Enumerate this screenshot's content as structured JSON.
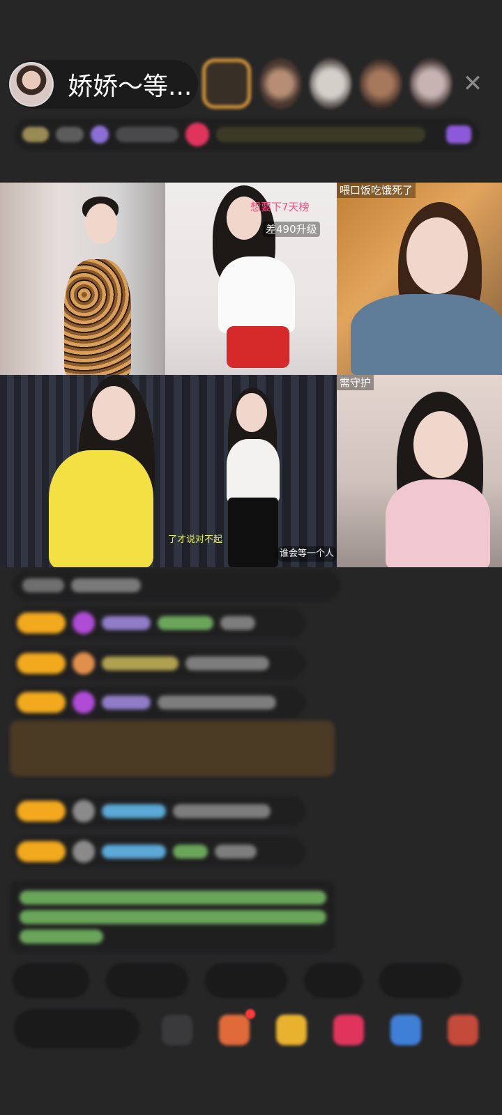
{
  "header": {
    "host_name": "娇娇～等..."
  },
  "streams": {
    "tile2_top": "想要下7天榜",
    "tile2_level": "差490升级",
    "tile3_top": "喂口饭吃饿死了",
    "tile4_bottom": "了才说对不起",
    "tile5_bottom": "谁会等一个人",
    "tile6_top": "需守护"
  },
  "icons": {
    "close": "close-icon",
    "gift": "gift-icon",
    "more": "more-icon"
  },
  "colors": {
    "badge_gold": "#f2a91d",
    "accent_red": "#e0345c",
    "text_green": "#86c26b",
    "text_blue": "#5aa9d6",
    "gem_purple": "#b04bd8"
  }
}
